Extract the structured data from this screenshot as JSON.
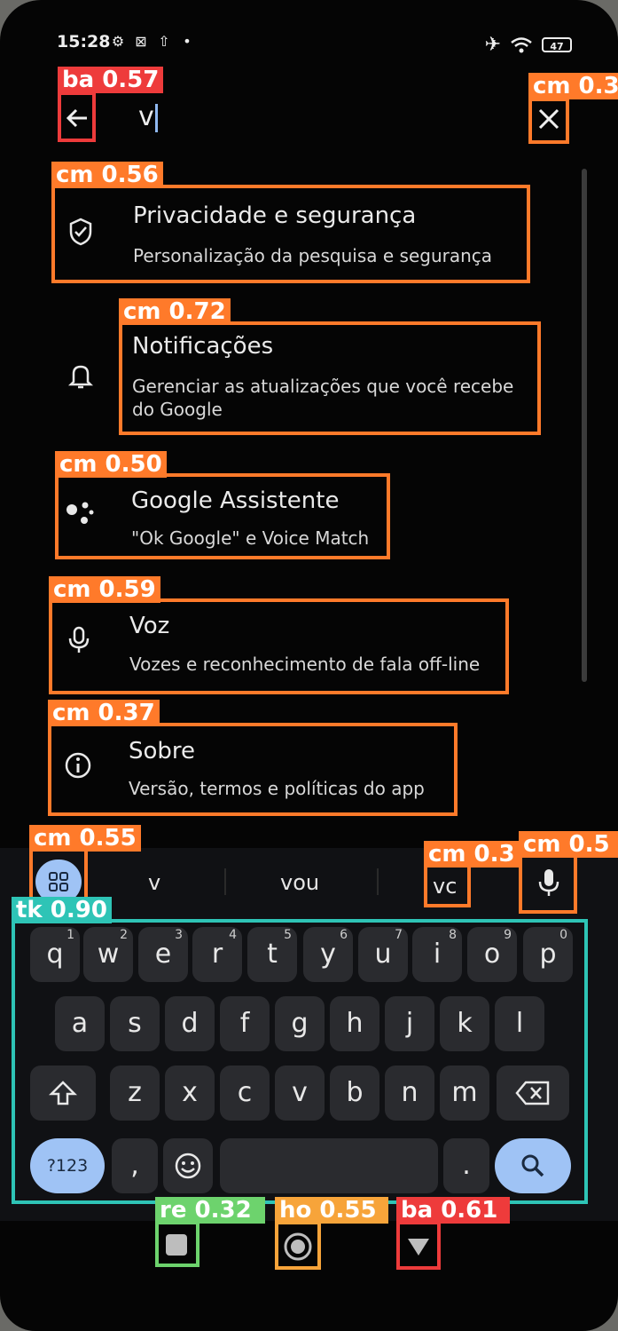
{
  "status_bar": {
    "time": "15:28",
    "battery": "47"
  },
  "search": {
    "query": "v"
  },
  "results": [
    {
      "title": "Privacidade e segurança",
      "subtitle": "Personalização da pesquisa e segurança"
    },
    {
      "title": "Notificações",
      "subtitle_line1": "Gerenciar as atualizações que você recebe",
      "subtitle_line2": "do Google"
    },
    {
      "title": "Google Assistente",
      "subtitle": "\"Ok Google\" e Voice Match"
    },
    {
      "title": "Voz",
      "subtitle": "Vozes e reconhecimento de fala off-line"
    },
    {
      "title": "Sobre",
      "subtitle": "Versão, termos e políticas do app"
    }
  ],
  "suggestions": [
    "v",
    "vou",
    "vc"
  ],
  "keyboard": {
    "row1": [
      {
        "k": "q",
        "n": "1"
      },
      {
        "k": "w",
        "n": "2"
      },
      {
        "k": "e",
        "n": "3"
      },
      {
        "k": "r",
        "n": "4"
      },
      {
        "k": "t",
        "n": "5"
      },
      {
        "k": "y",
        "n": "6"
      },
      {
        "k": "u",
        "n": "7"
      },
      {
        "k": "i",
        "n": "8"
      },
      {
        "k": "o",
        "n": "9"
      },
      {
        "k": "p",
        "n": "0"
      }
    ],
    "row2": [
      "a",
      "s",
      "d",
      "f",
      "g",
      "h",
      "j",
      "k",
      "l"
    ],
    "row3": [
      "z",
      "x",
      "c",
      "v",
      "b",
      "n",
      "m"
    ],
    "symbols_label": "?123",
    "comma": ",",
    "period": "."
  },
  "detections": {
    "back": "ba 0.57",
    "close": "cm 0.3",
    "r0": "cm 0.56",
    "r1": "cm 0.72",
    "r2": "cm 0.50",
    "r3": "cm 0.59",
    "r4": "cm 0.37",
    "grid": "cm 0.55",
    "vc": "cm 0.3",
    "mic": "cm 0.5",
    "keyboard": "tk 0.90",
    "recents": "re 0.32",
    "home": "ho 0.55",
    "navback": "ba 0.61"
  },
  "colors": {
    "cm": "#ff7a2a",
    "ba": "#ee3b3b",
    "tk": "#2ec4b6",
    "re": "#6dd36d",
    "ho": "#f7a43a",
    "accent": "#9fc3f5"
  }
}
